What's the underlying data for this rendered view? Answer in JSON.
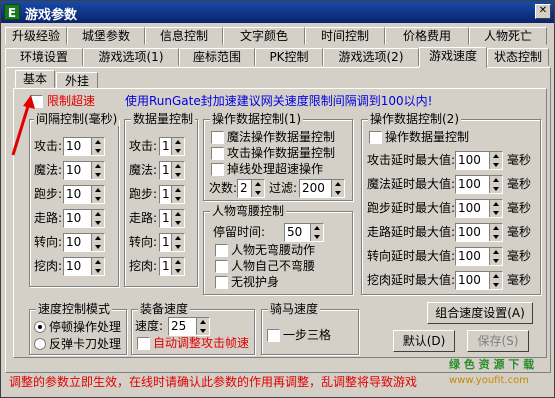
{
  "window": {
    "title": "游戏参数",
    "app_icon": "E"
  },
  "tabs_row1": [
    "升级经验",
    "城堡参数",
    "信息控制",
    "文字颜色",
    "时间控制",
    "价格费用",
    "人物死亡"
  ],
  "tabs_row2": [
    "环境设置",
    "游戏选项(1)",
    "座标范围",
    "PK控制",
    "游戏选项(2)",
    "游戏速度",
    "状态控制"
  ],
  "active_tab": "游戏速度",
  "subtabs": [
    "基本",
    "外挂"
  ],
  "limit_speed": {
    "label": "限制超速",
    "checked": false
  },
  "notice": "使用RunGate封加速建议网关速度限制间隔调到100以内!",
  "interval": {
    "title": "间隔控制(毫秒)",
    "rows": [
      {
        "label": "攻击:",
        "value": "10"
      },
      {
        "label": "魔法:",
        "value": "10"
      },
      {
        "label": "跑步:",
        "value": "10"
      },
      {
        "label": "走路:",
        "value": "10"
      },
      {
        "label": "转向:",
        "value": "10"
      },
      {
        "label": "挖肉:",
        "value": "10"
      }
    ]
  },
  "count": {
    "title": "数据量控制",
    "rows": [
      {
        "label": "攻击:",
        "value": "1"
      },
      {
        "label": "魔法:",
        "value": "1"
      },
      {
        "label": "跑步:",
        "value": "1"
      },
      {
        "label": "走路:",
        "value": "1"
      },
      {
        "label": "转向:",
        "value": "1"
      },
      {
        "label": "挖肉:",
        "value": "1"
      }
    ]
  },
  "op1": {
    "title": "操作数据控制(1)",
    "checks": [
      "魔法操作数据量控制",
      "攻击操作数据量控制",
      "掉线处理超速操作"
    ],
    "times_label": "次数:",
    "times_value": "2",
    "filter_label": "过滤:",
    "filter_value": "200"
  },
  "bend": {
    "title": "人物弯腰控制",
    "stay_label": "停留时间:",
    "stay_value": "50",
    "checks": [
      "人物无弯腰动作",
      "人物自己不弯腰",
      "无视护身"
    ]
  },
  "op2": {
    "title": "操作数据控制(2)",
    "check": "操作数据量控制",
    "unit": "毫秒",
    "rows": [
      {
        "label": "攻击延时最大值:",
        "value": "100"
      },
      {
        "label": "魔法延时最大值:",
        "value": "100"
      },
      {
        "label": "跑步延时最大值:",
        "value": "100"
      },
      {
        "label": "走路延时最大值:",
        "value": "100"
      },
      {
        "label": "转向延时最大值:",
        "value": "100"
      },
      {
        "label": "挖肉延时最大值:",
        "value": "100"
      }
    ]
  },
  "mode": {
    "title": "速度控制模式",
    "options": [
      "停顿操作处理",
      "反弹卡刀处理"
    ],
    "selected": 0
  },
  "equip": {
    "title": "装备速度",
    "speed_label": "速度:",
    "speed_value": "25",
    "auto_check": "自动调整攻击帧速"
  },
  "horse": {
    "title": "骑马速度",
    "check": "一步三格"
  },
  "buttons": {
    "combo": "组合速度设置(A)",
    "default": "默认(D)",
    "save": "保存(S)"
  },
  "footer": "调整的参数立即生效，在线时请确认此参数的作用再调整，乱调整将导致游戏",
  "watermark": {
    "line1": "绿 色 资 源 下 载",
    "line2": "www.youfit.com"
  },
  "colors": {
    "title_bar": "#0a246a",
    "warning": "#e00000",
    "notice": "#0000e0"
  }
}
